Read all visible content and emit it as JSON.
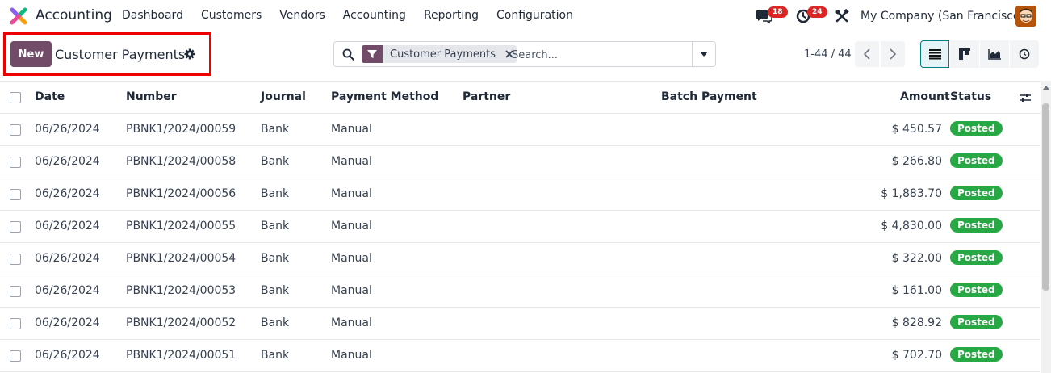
{
  "topnav": {
    "app_name": "Accounting",
    "menu": [
      "Dashboard",
      "Customers",
      "Vendors",
      "Accounting",
      "Reporting",
      "Configuration"
    ],
    "chat_count": "18",
    "activity_count": "24",
    "company": "My Company (San Francisco)"
  },
  "control": {
    "new_label": "New",
    "title": "Customer Payments",
    "search": {
      "facet": "Customer Payments",
      "placeholder": "Search..."
    },
    "pager": "1-44 / 44"
  },
  "table": {
    "headers": {
      "date": "Date",
      "number": "Number",
      "journal": "Journal",
      "payment_method": "Payment Method",
      "partner": "Partner",
      "batch_payment": "Batch Payment",
      "amount": "Amount",
      "status": "Status"
    },
    "rows": [
      {
        "date": "06/26/2024",
        "number": "PBNK1/2024/00059",
        "journal": "Bank",
        "method": "Manual",
        "amount": "$ 450.57",
        "status": "Posted"
      },
      {
        "date": "06/26/2024",
        "number": "PBNK1/2024/00058",
        "journal": "Bank",
        "method": "Manual",
        "amount": "$ 266.80",
        "status": "Posted"
      },
      {
        "date": "06/26/2024",
        "number": "PBNK1/2024/00056",
        "journal": "Bank",
        "method": "Manual",
        "amount": "$ 1,883.70",
        "status": "Posted"
      },
      {
        "date": "06/26/2024",
        "number": "PBNK1/2024/00055",
        "journal": "Bank",
        "method": "Manual",
        "amount": "$ 4,830.00",
        "status": "Posted"
      },
      {
        "date": "06/26/2024",
        "number": "PBNK1/2024/00054",
        "journal": "Bank",
        "method": "Manual",
        "amount": "$ 322.00",
        "status": "Posted"
      },
      {
        "date": "06/26/2024",
        "number": "PBNK1/2024/00053",
        "journal": "Bank",
        "method": "Manual",
        "amount": "$ 161.00",
        "status": "Posted"
      },
      {
        "date": "06/26/2024",
        "number": "PBNK1/2024/00052",
        "journal": "Bank",
        "method": "Manual",
        "amount": "$ 828.92",
        "status": "Posted"
      },
      {
        "date": "06/26/2024",
        "number": "PBNK1/2024/00051",
        "journal": "Bank",
        "method": "Manual",
        "amount": "$ 702.70",
        "status": "Posted"
      }
    ]
  },
  "icons": {
    "logo": "accounting-logo-icon",
    "chat": "chat-icon",
    "activity": "clock-icon",
    "tools": "tools-icon",
    "gear": "gear-icon",
    "search": "search-icon",
    "filter": "filter-icon",
    "close": "close-icon",
    "caret": "caret-down-icon",
    "list": "list-view-icon",
    "kanban": "kanban-view-icon",
    "graph": "graph-view-icon",
    "activity_view": "activity-view-icon",
    "settings": "column-settings-icon"
  },
  "colors": {
    "brand": "#714b67",
    "posted": "#28a745",
    "badge": "#dc2626",
    "active_view": "#017e84"
  }
}
